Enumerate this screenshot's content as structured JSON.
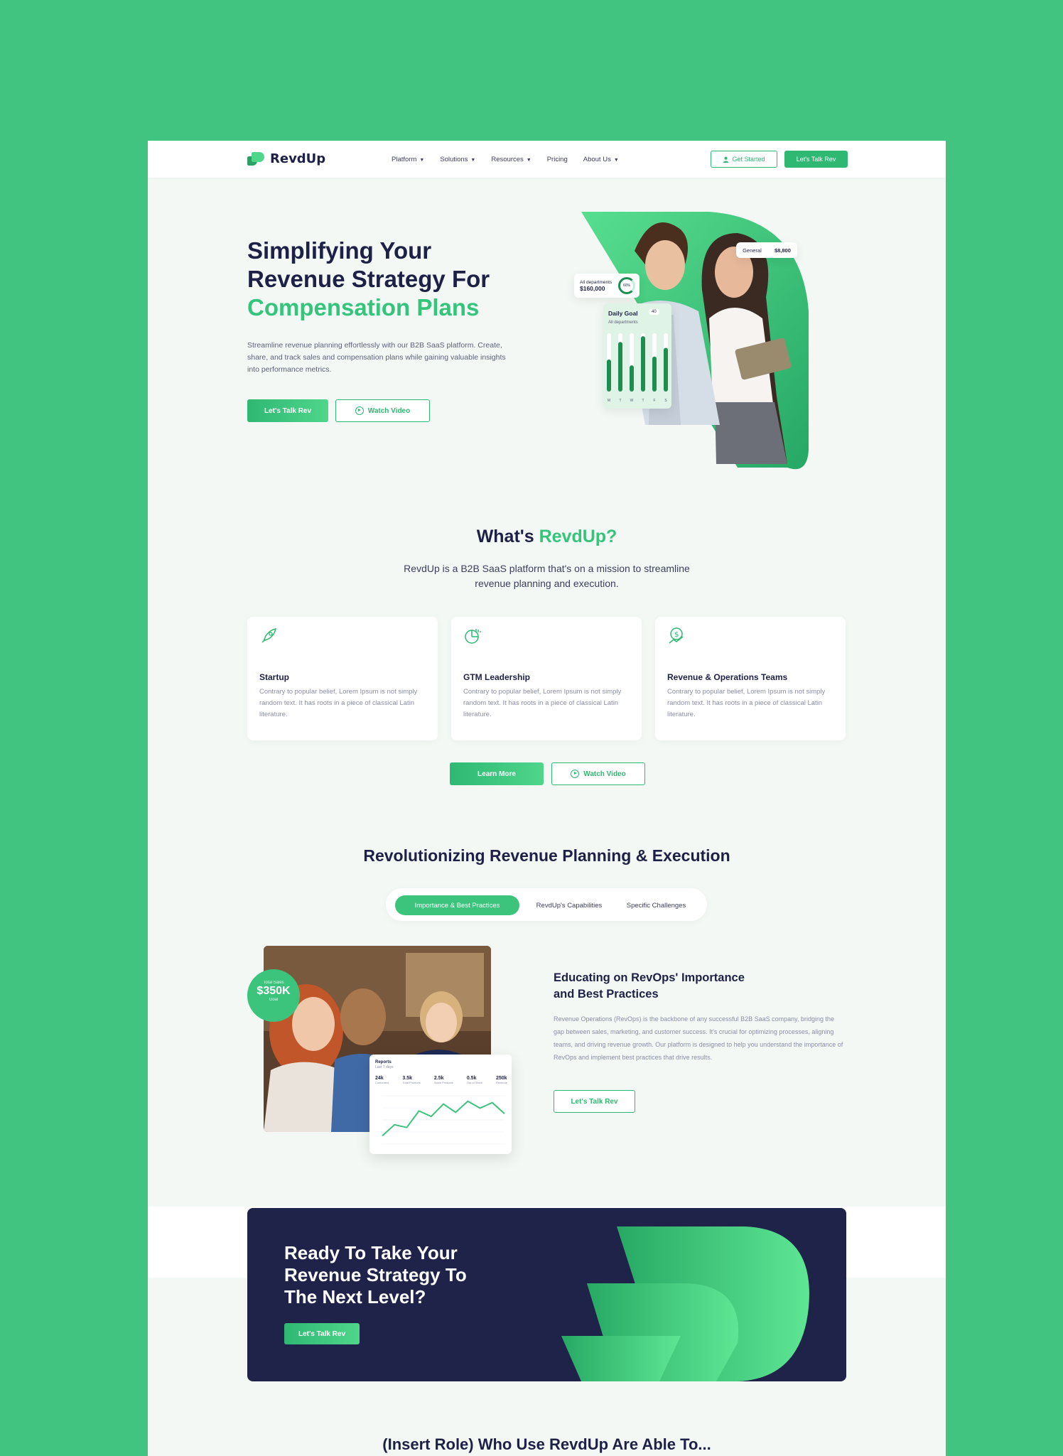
{
  "brand": {
    "name": "RevdUp",
    "accent": "#34c47c",
    "navy": "#1e2146"
  },
  "nav": {
    "items": [
      {
        "label": "Platform",
        "dropdown": true
      },
      {
        "label": "Solutions",
        "dropdown": true
      },
      {
        "label": "Resources",
        "dropdown": true
      },
      {
        "label": "Pricing",
        "dropdown": false
      },
      {
        "label": "About Us",
        "dropdown": true
      }
    ],
    "get_started": "Get Started",
    "talk": "Let's Talk Rev"
  },
  "hero": {
    "title_line1": "Simplifying Your",
    "title_line2": "Revenue Strategy For",
    "title_accent": "Compensation Plans",
    "subtitle": "Streamline revenue planning effortlessly with our B2B SaaS platform. Create, share, and track sales and compensation plans while gaining valuable insights into performance metrics.",
    "primary_cta": "Let's Talk Rev",
    "secondary_cta": "Watch Video",
    "stat_general_label": "General",
    "stat_general_value": "$8,800",
    "stat_dept_label": "All departments",
    "stat_dept_value": "$160,000",
    "stat_dept_pct": "60%",
    "daily_goal_label": "Daily Goal",
    "daily_goal_value": "40",
    "daily_goal_sub": "All departments",
    "daily_goal_bars": [
      0.55,
      0.85,
      0.45,
      0.95,
      0.6,
      0.75
    ],
    "daily_goal_days": [
      "M",
      "T",
      "W",
      "T",
      "F",
      "S"
    ]
  },
  "about": {
    "title_prefix": "What's ",
    "title_accent": "RevdUp?",
    "subtitle_line1": "RevdUp is a B2B SaaS platform that's on a mission to streamline",
    "subtitle_line2": "revenue planning and execution.",
    "cards": [
      {
        "icon": "rocket-icon",
        "title": "Startup",
        "text": "Contrary to popular belief, Lorem Ipsum is not simply random text. It has roots in a piece of classical Latin literature."
      },
      {
        "icon": "pie-chart-icon",
        "title": "GTM Leadership",
        "text": "Contrary to popular belief, Lorem Ipsum is not simply random text. It has roots in a piece of classical Latin literature."
      },
      {
        "icon": "money-growth-icon",
        "title": "Revenue & Operations Teams",
        "text": "Contrary to popular belief, Lorem Ipsum is not simply random text. It has roots in a piece of classical Latin literature."
      }
    ],
    "learn_more": "Learn More",
    "watch_video": "Watch Video"
  },
  "revolution": {
    "title": "Revolutionizing Revenue Planning & Execution",
    "tabs": [
      {
        "label": "Importance & Best Practices",
        "active": true
      },
      {
        "label": "RevdUp's Capabilities",
        "active": false
      },
      {
        "label": "Specific Challenges",
        "active": false
      }
    ],
    "badge_top": "Total Sales",
    "badge_value": "$350K",
    "badge_bottom": "Goal",
    "dash_title": "Reports",
    "dash_sub": "Last 7 days",
    "dash_stats": [
      {
        "value": "24k",
        "label": "Customers"
      },
      {
        "value": "3.5k",
        "label": "Total Products"
      },
      {
        "value": "2.5k",
        "label": "Stock Products"
      },
      {
        "value": "0.5k",
        "label": "Out of Stock"
      },
      {
        "value": "250k",
        "label": "Revenue"
      }
    ],
    "dash_line": [
      12,
      28,
      24,
      48,
      40,
      58,
      46,
      62,
      52,
      60,
      44
    ],
    "heading_line1": "Educating on RevOps' Importance",
    "heading_line2": "and Best Practices",
    "body": "Revenue Operations (RevOps) is the backbone of any successful B2B SaaS company, bridging the gap between sales, marketing, and customer success. It's crucial for optimizing processes, aligning teams, and driving revenue growth. Our platform is designed to help you understand the importance of RevOps and implement best practices that drive results.",
    "cta": "Let's Talk Rev"
  },
  "cta_band": {
    "line1": "Ready To Take Your",
    "line2": "Revenue Strategy To",
    "line3": "The Next Level?",
    "button": "Let's Talk Rev"
  },
  "roles": {
    "title": "(Insert Role) Who Use RevdUp Are Able To..."
  }
}
